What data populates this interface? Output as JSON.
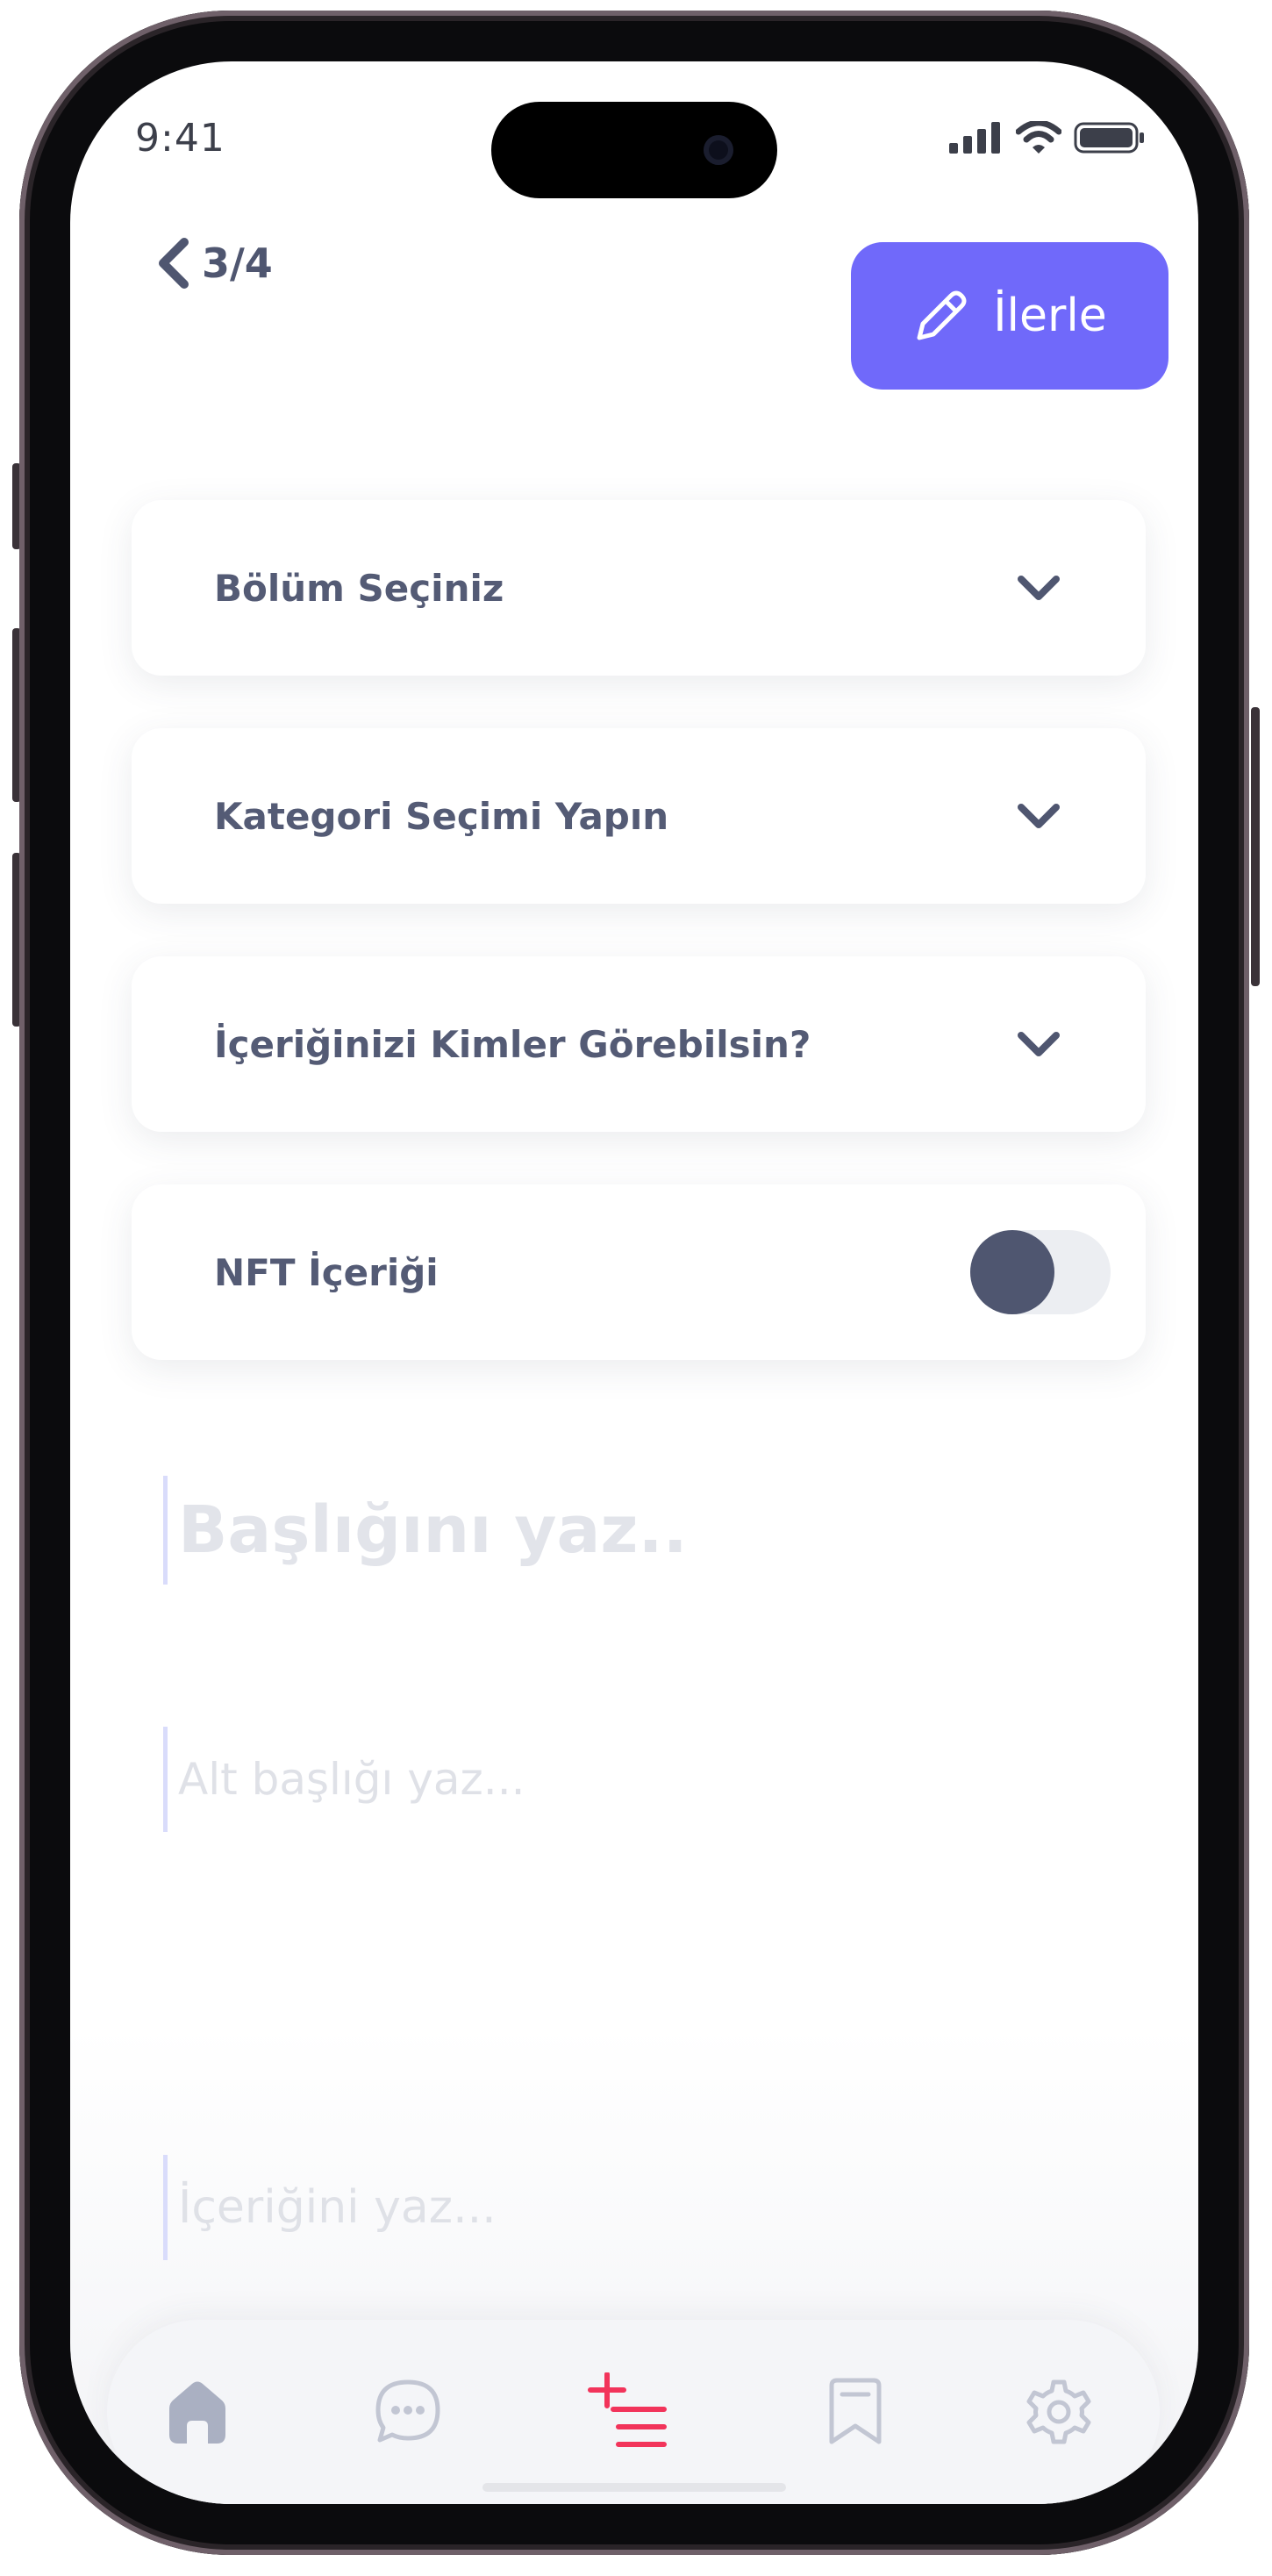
{
  "status_bar": {
    "time": "9:41",
    "icons": [
      "cellular-signal-icon",
      "wifi-icon",
      "battery-icon"
    ]
  },
  "header": {
    "back_icon": "chevron-left-icon",
    "step_indicator": "3/4",
    "next_button": {
      "label": "İlerle",
      "icon": "pencil-icon",
      "color": "#7069fa"
    }
  },
  "form": {
    "dropdowns": [
      {
        "label": "Bölüm Seçiniz",
        "icon": "chevron-down-icon"
      },
      {
        "label": "Kategori Seçimi Yapın",
        "icon": "chevron-down-icon"
      },
      {
        "label": "İçeriğinizi Kimler Görebilsin?",
        "icon": "chevron-down-icon"
      }
    ],
    "nft_toggle": {
      "label": "NFT İçeriği",
      "state": "off"
    },
    "title_placeholder": "Başlığını yaz..",
    "subtitle_placeholder": "Alt başlığı yaz...",
    "content_placeholder": "İçeriğini yaz..."
  },
  "tab_bar": {
    "active_index": 2,
    "active_color": "#f2345b",
    "items": [
      {
        "name": "home",
        "icon": "home-icon"
      },
      {
        "name": "messages",
        "icon": "chat-bubble-icon"
      },
      {
        "name": "create",
        "icon": "add-list-icon"
      },
      {
        "name": "saved",
        "icon": "bookmark-icon"
      },
      {
        "name": "settings",
        "icon": "gear-icon"
      }
    ]
  }
}
